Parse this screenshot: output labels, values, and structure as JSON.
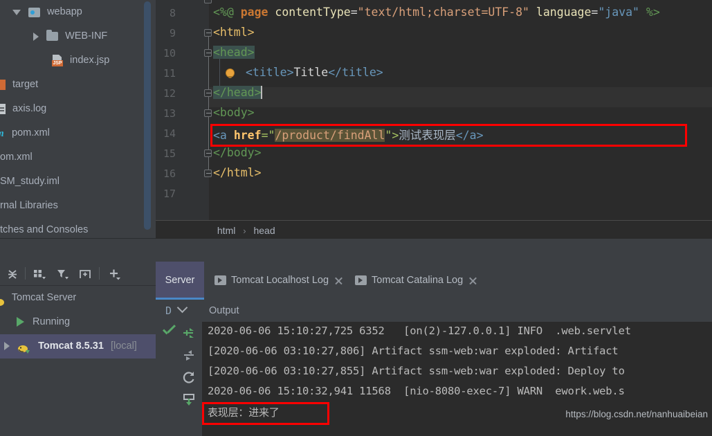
{
  "project_tree": {
    "items": [
      {
        "label": "webapp",
        "icon": "module-content-icon",
        "arrow": "down",
        "indent": 18,
        "truncated": false
      },
      {
        "label": "WEB-INF",
        "icon": "folder-icon",
        "arrow": "right",
        "indent": 48,
        "truncated": false
      },
      {
        "label": "index.jsp",
        "icon": "jsp-file-icon",
        "arrow": "none",
        "indent": 48,
        "truncated": false
      },
      {
        "label": "target",
        "icon": "excluded-folder-icon",
        "arrow": "none",
        "indent": -6,
        "truncated": true
      },
      {
        "label": "axis.log",
        "icon": "log-file-icon",
        "arrow": "none",
        "indent": -8,
        "truncated": true
      },
      {
        "label": "pom.xml",
        "icon": "maven-file-icon",
        "arrow": "none",
        "indent": -6,
        "truncated": true
      },
      {
        "label": "om.xml",
        "icon": "none",
        "arrow": "none",
        "indent": -4,
        "truncated": true
      },
      {
        "label": "SM_study.iml",
        "icon": "none",
        "arrow": "none",
        "indent": -4,
        "truncated": true
      },
      {
        "label": "rnal Libraries",
        "icon": "none",
        "arrow": "none",
        "indent": -4,
        "truncated": true
      },
      {
        "label": "tches and Consoles",
        "icon": "none",
        "arrow": "none",
        "indent": -4,
        "truncated": true
      }
    ]
  },
  "editor": {
    "lines": [
      {
        "number": "8",
        "fold": false,
        "bulb": false
      },
      {
        "number": "9",
        "fold": true,
        "bulb": false
      },
      {
        "number": "10",
        "fold": true,
        "bulb": false
      },
      {
        "number": "11",
        "fold": false,
        "bulb": true
      },
      {
        "number": "12",
        "fold": true,
        "bulb": false
      },
      {
        "number": "13",
        "fold": true,
        "bulb": false
      },
      {
        "number": "14",
        "fold": false,
        "bulb": false
      },
      {
        "number": "15",
        "fold": true,
        "bulb": false
      },
      {
        "number": "16",
        "fold": true,
        "bulb": false
      },
      {
        "number": "17",
        "fold": false,
        "bulb": false
      }
    ],
    "code": {
      "l8_a": "<%@ ",
      "l8_b": "page ",
      "l8_c": "contentType",
      "l8_d": "=",
      "l8_e": "\"text/html;charset=UTF-8\"",
      "l8_f": " language",
      "l8_g": "=",
      "l8_h": "\"java\"",
      "l8_i": " %>",
      "l9": "<html>",
      "l10": "<head>",
      "l11_a": "<title>",
      "l11_b": "Title",
      "l11_c": "</title>",
      "l12": "</head>",
      "l13": "<body>",
      "l14_a": "<a ",
      "l14_b": "href",
      "l14_c": "=\"",
      "l14_d": "/product/findAll",
      "l14_e": "\">",
      "l14_f": "测试表现层",
      "l14_g": "</a>",
      "l15": "</body>",
      "l16": "</html>"
    }
  },
  "breadcrumb": {
    "items": [
      "html",
      "head"
    ],
    "separator": "›"
  },
  "server_toolbar": {
    "icons": [
      "collapse-all-icon",
      "group-by-icon",
      "filter-icon",
      "add-frame-icon",
      "add-icon"
    ]
  },
  "server_tree": {
    "rows": [
      {
        "label": "Tomcat Server",
        "kind": "group",
        "icon": "tomcat-icon",
        "selected": false
      },
      {
        "label": "Running",
        "kind": "status",
        "icon": "run-icon",
        "selected": false
      },
      {
        "label": "Tomcat 8.5.31",
        "suffix": "[local]",
        "kind": "instance",
        "icon": "tomcat-icon",
        "selected": true
      }
    ]
  },
  "console": {
    "tabs": [
      {
        "label": "Server",
        "active": true,
        "has_icon": false,
        "closable": false
      },
      {
        "label": "Tomcat Localhost Log",
        "active": false,
        "has_icon": true,
        "closable": true
      },
      {
        "label": "Tomcat Catalina Log",
        "active": false,
        "has_icon": true,
        "closable": true
      }
    ],
    "debug_letter": "D",
    "output_label": "Output",
    "side_icons": [
      "rerun-icon",
      "step-icon",
      "restart-icon",
      "scroll-to-end-icon"
    ],
    "log_lines": [
      "2020-06-06 15:10:27,725 6352   [on(2)-127.0.0.1] INFO  .web.servlet",
      "[2020-06-06 03:10:27,806] Artifact ssm-web:war exploded: Artifact ",
      "[2020-06-06 03:10:27,855] Artifact ssm-web:war exploded: Deploy to",
      "2020-06-06 15:10:32,941 11568  [nio-8080-exec-7] WARN  ework.web.s",
      "表现层：进来了"
    ],
    "watermark": "https://blog.csdn.net/nanhuaibeian"
  },
  "colors": {
    "annotation_red": "#ff0000",
    "tab_active_bg": "#4e4f6b",
    "tab_underline": "#4a88c7",
    "editor_bg": "#2b2b2b",
    "panel_bg": "#3c3f43",
    "running_green": "#59a869"
  }
}
